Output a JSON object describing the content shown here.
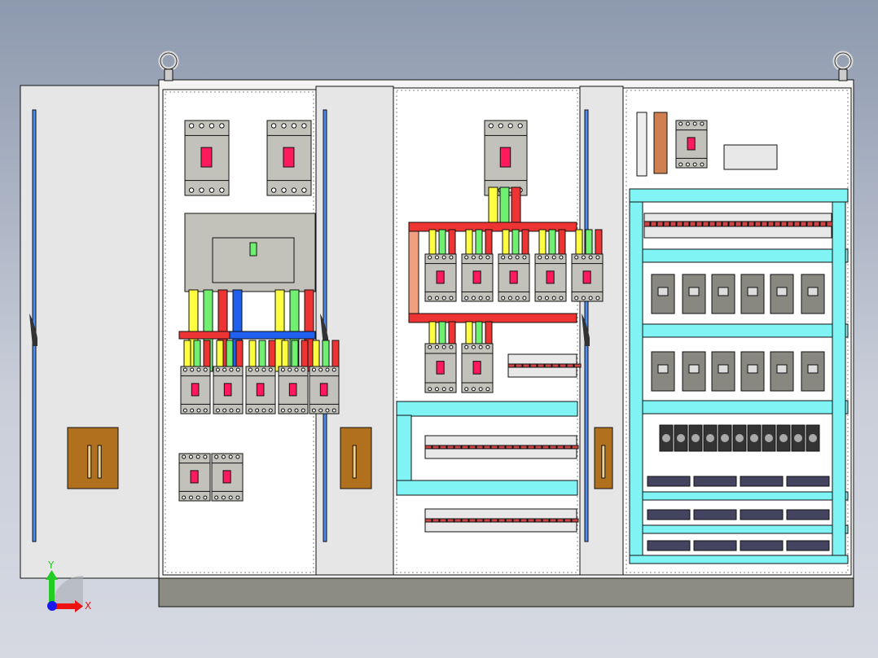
{
  "triad": {
    "x_label": "X",
    "y_label": "Y"
  },
  "colors": {
    "enclosure": "#f4f4f2",
    "door": "#e6e6e6",
    "plinth": "#8c8c82",
    "breaker": "#c2c2ba",
    "breaker_switch": "#ff1a5e",
    "busbar": "#ee3333",
    "rail": "#80f4f4",
    "handle": "#b0701e",
    "door_rod": "#4a8cf0",
    "phase_colors": [
      "#ffff40",
      "#70f070",
      "#ee3333",
      "#2060f0"
    ],
    "axis_x": "#ee1111",
    "axis_y": "#22cc22",
    "axis_origin": "#1a1aee"
  }
}
